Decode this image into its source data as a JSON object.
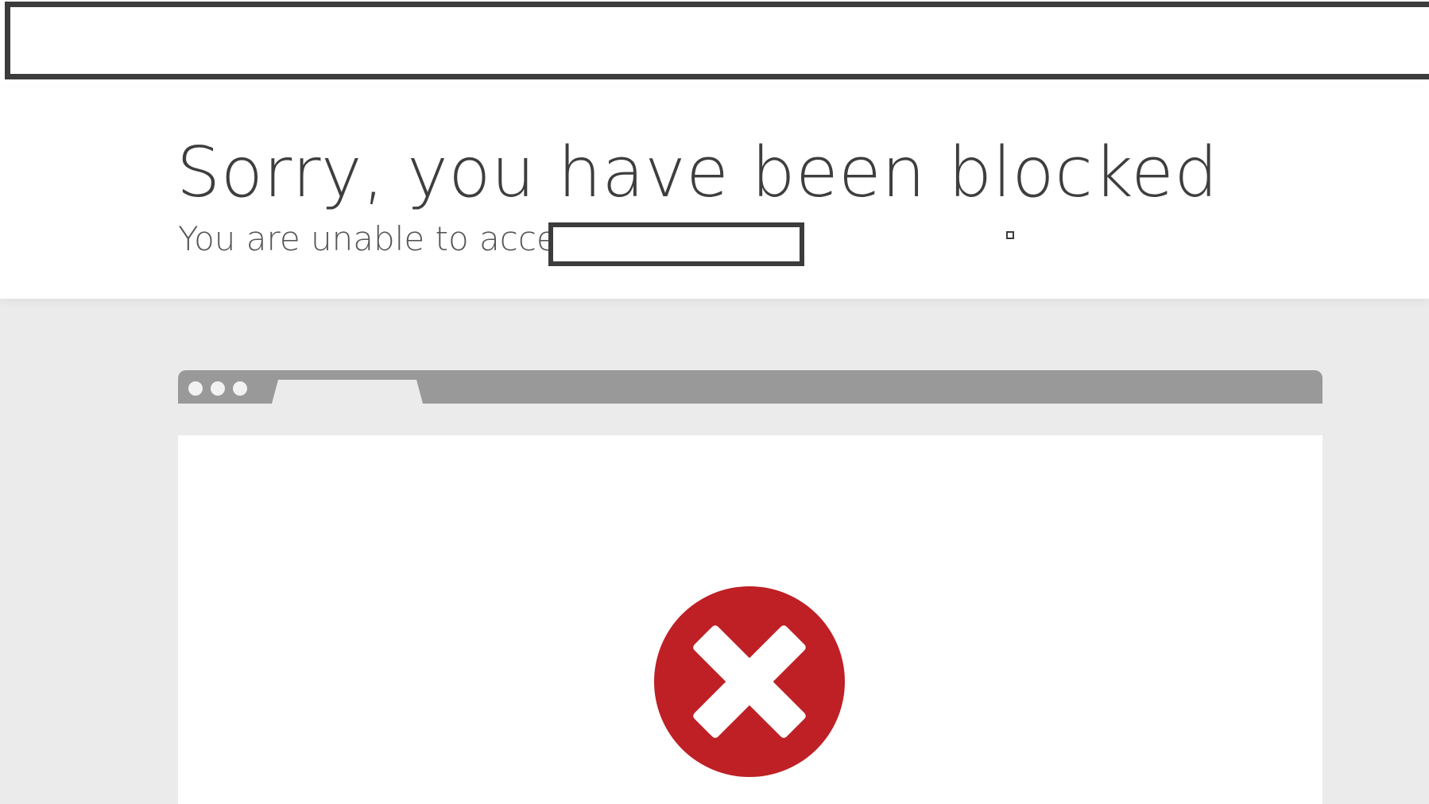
{
  "page": {
    "title": "Sorry, you have been blocked",
    "subtitle": "You are unable to access"
  },
  "illustration": {
    "icon": "error-x-icon",
    "icon_color": "#be2025",
    "browser_bar_color": "#999999",
    "background_color": "#ebebeb"
  }
}
